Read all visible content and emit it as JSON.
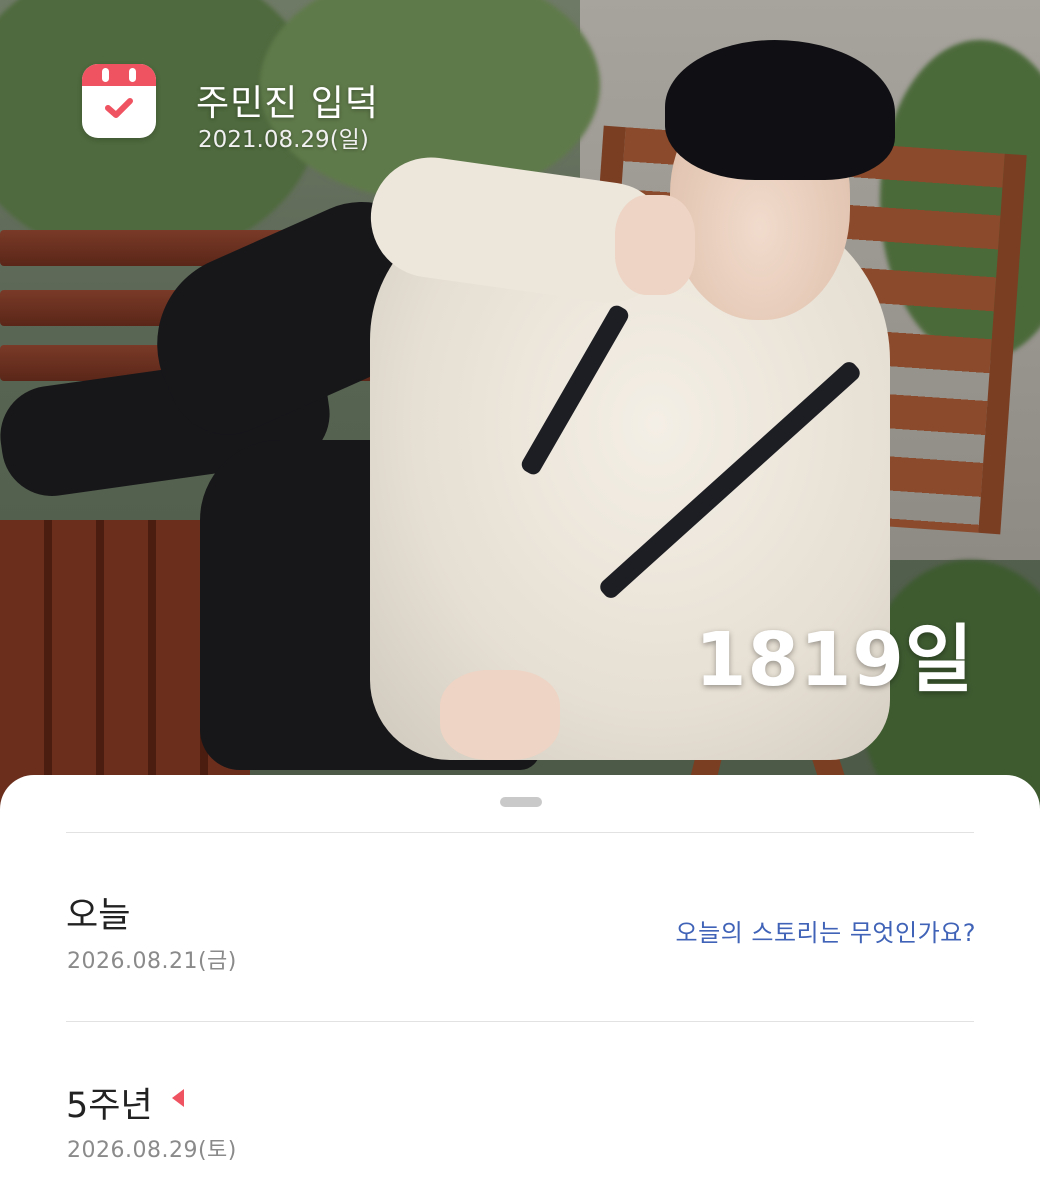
{
  "event": {
    "title": "주민진 입덕",
    "date": "2021.08.29(일)",
    "dday_count": "1819일",
    "icon": "calendar-check-icon"
  },
  "sheet": {
    "today": {
      "label": "오늘",
      "date": "2026.08.21(금)",
      "prompt": "오늘의 스토리는 무엇인가요?"
    },
    "anniversary": {
      "label": "5주년",
      "date": "2026.08.29(토)",
      "icon": "red-flag-icon"
    }
  },
  "colors": {
    "accent_red": "#ef5261",
    "link_blue": "#4063b8"
  }
}
